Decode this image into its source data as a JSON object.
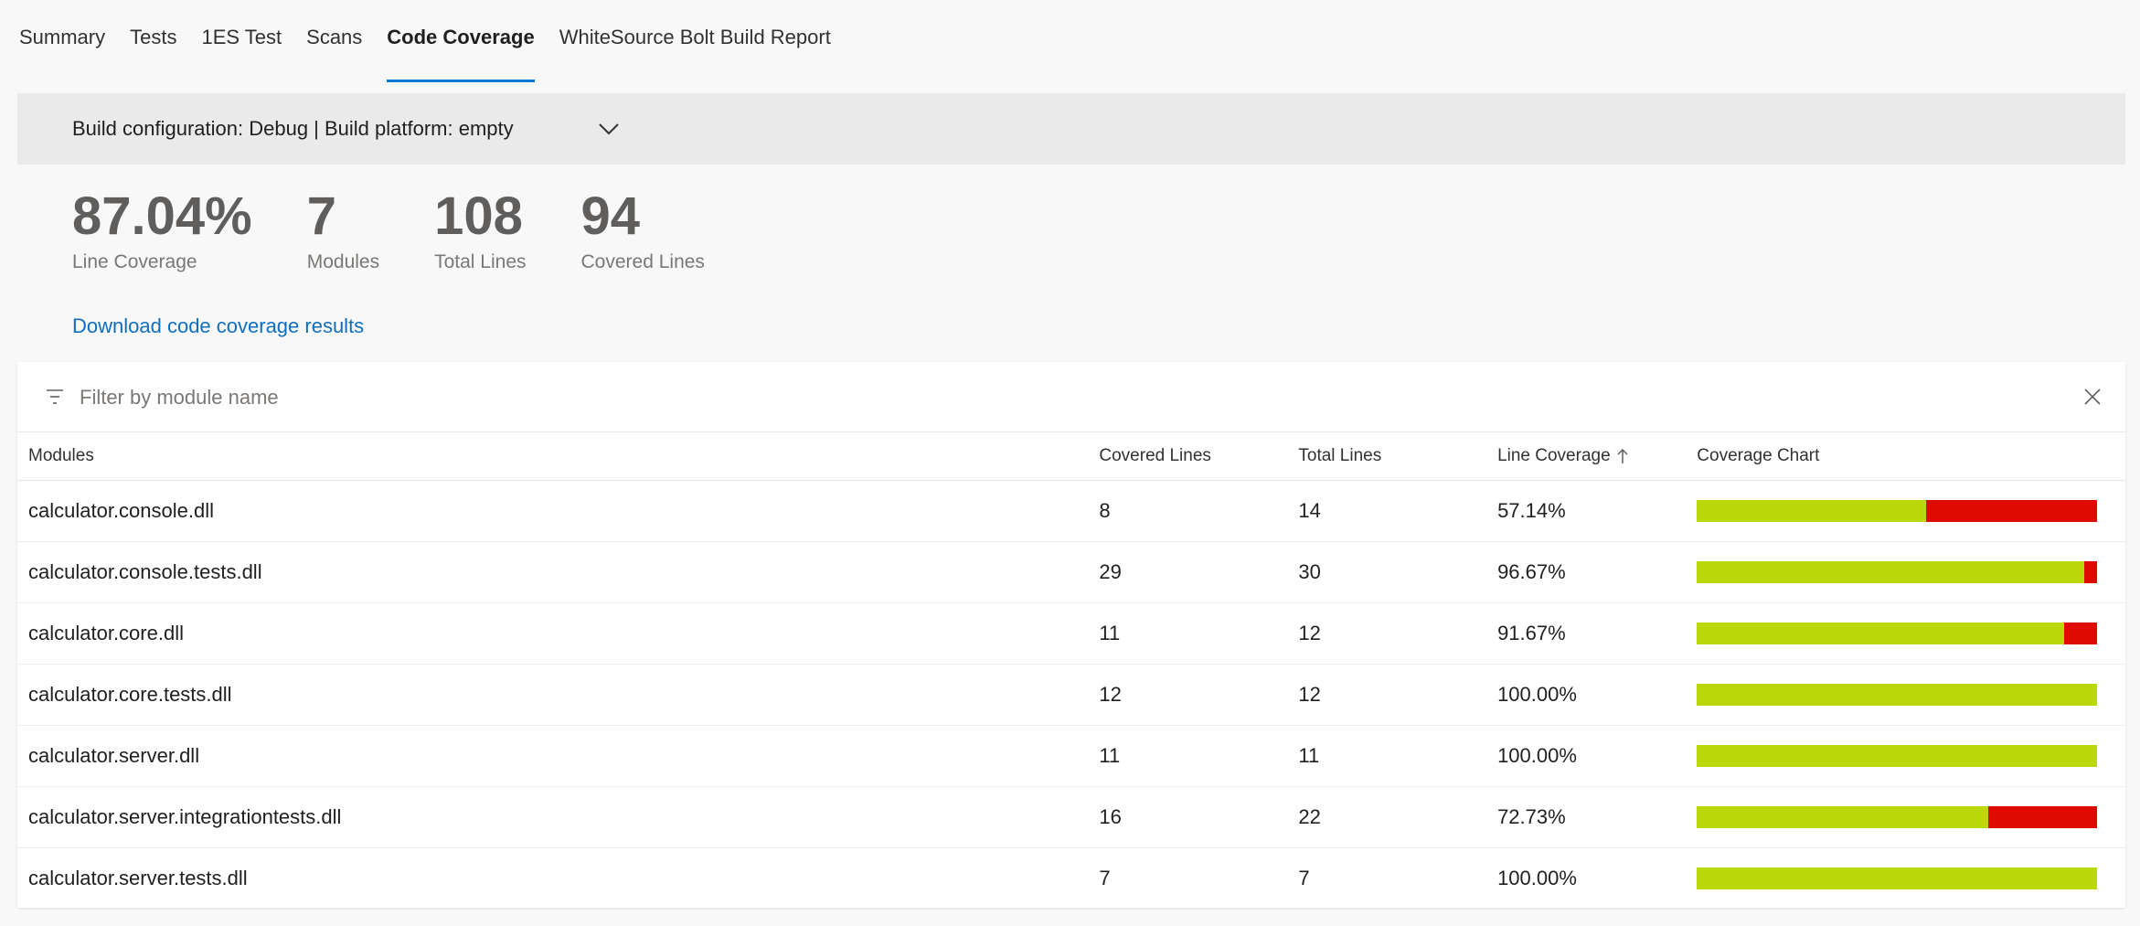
{
  "tabs": [
    {
      "label": "Summary",
      "active": false
    },
    {
      "label": "Tests",
      "active": false
    },
    {
      "label": "1ES Test",
      "active": false
    },
    {
      "label": "Scans",
      "active": false
    },
    {
      "label": "Code Coverage",
      "active": true
    },
    {
      "label": "WhiteSource Bolt Build Report",
      "active": false
    }
  ],
  "config": {
    "label": "Build configuration: Debug | Build platform: empty",
    "chevron_icon": "chevron-down-icon"
  },
  "metrics": {
    "line_coverage": {
      "value": "87.04%",
      "label": "Line Coverage"
    },
    "modules": {
      "value": "7",
      "label": "Modules"
    },
    "total_lines": {
      "value": "108",
      "label": "Total Lines"
    },
    "covered_lines": {
      "value": "94",
      "label": "Covered Lines"
    }
  },
  "download": {
    "label": "Download code coverage results"
  },
  "filter": {
    "placeholder": "Filter by module name",
    "icon": "filter-icon",
    "clear_icon": "close-icon"
  },
  "table": {
    "headers": {
      "modules": "Modules",
      "covered": "Covered Lines",
      "total": "Total Lines",
      "line_coverage": "Line Coverage",
      "chart": "Coverage Chart"
    },
    "sort_icon": "arrow-up-icon",
    "rows": [
      {
        "module": "calculator.console.dll",
        "covered": "8",
        "total": "14",
        "coverage": "57.14%",
        "fraction": 0.5714
      },
      {
        "module": "calculator.console.tests.dll",
        "covered": "29",
        "total": "30",
        "coverage": "96.67%",
        "fraction": 0.9667
      },
      {
        "module": "calculator.core.dll",
        "covered": "11",
        "total": "12",
        "coverage": "91.67%",
        "fraction": 0.9167
      },
      {
        "module": "calculator.core.tests.dll",
        "covered": "12",
        "total": "12",
        "coverage": "100.00%",
        "fraction": 1.0
      },
      {
        "module": "calculator.server.dll",
        "covered": "11",
        "total": "11",
        "coverage": "100.00%",
        "fraction": 1.0
      },
      {
        "module": "calculator.server.integrationtests.dll",
        "covered": "16",
        "total": "22",
        "coverage": "72.73%",
        "fraction": 0.7273
      },
      {
        "module": "calculator.server.tests.dll",
        "covered": "7",
        "total": "7",
        "coverage": "100.00%",
        "fraction": 1.0
      }
    ]
  },
  "colors": {
    "covered": "#bad80a",
    "uncovered": "#e00b00",
    "accent": "#0078d4",
    "link": "#106ebe"
  }
}
